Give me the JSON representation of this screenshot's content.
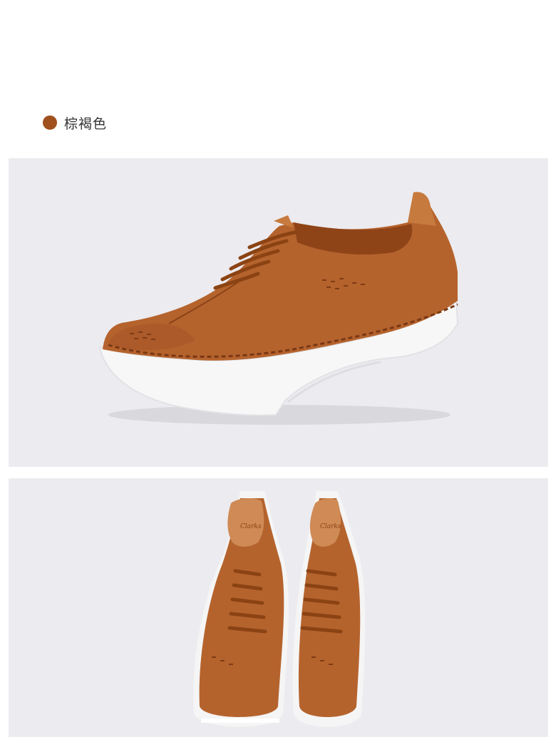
{
  "product": {
    "color_name": "棕褐色",
    "swatch_color": "#a0501e",
    "brand_insole_text": "Clarks"
  },
  "images": [
    {
      "view": "side",
      "background": "#ecebef"
    },
    {
      "view": "top",
      "background": "#ecebef"
    }
  ]
}
